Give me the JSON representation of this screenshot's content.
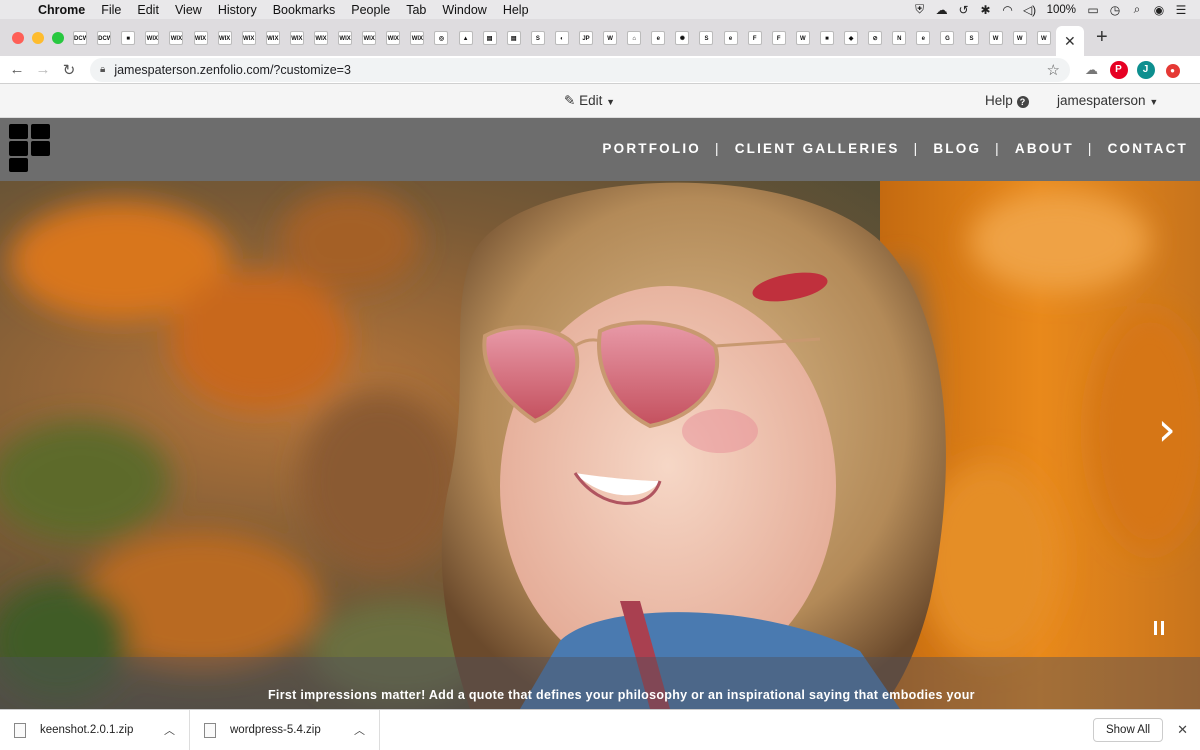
{
  "menubar": {
    "items": [
      "Chrome",
      "File",
      "Edit",
      "View",
      "History",
      "Bookmarks",
      "People",
      "Tab",
      "Window",
      "Help"
    ],
    "battery": "100%"
  },
  "tabs": {
    "favicons": [
      "DCW",
      "DCW",
      "■",
      "WIX",
      "WIX",
      "WIX",
      "WIX",
      "WIX",
      "WIX",
      "WIX",
      "WIX",
      "WIX",
      "WIX",
      "WIX",
      "WIX",
      "◎",
      "▲",
      "▤",
      "▤",
      "S",
      "◐",
      "JP",
      "W",
      "⌂",
      "e",
      "✺",
      "S",
      "e",
      "F",
      "F",
      "W",
      "■",
      "◆",
      "⊘",
      "N",
      "e",
      "G",
      "S",
      "W",
      "W",
      "W"
    ],
    "close_glyph": "✕",
    "new_tab": "+"
  },
  "toolbar": {
    "url": "jamespaterson.zenfolio.com/?customize=3",
    "avatar_letter": "J"
  },
  "editbar": {
    "edit_label": "Edit",
    "help_label": "Help",
    "username": "jamespaterson"
  },
  "site": {
    "nav": [
      "PORTFOLIO",
      "CLIENT GALLERIES",
      "BLOG",
      "ABOUT",
      "CONTACT"
    ],
    "separator": "|"
  },
  "hero": {
    "quote": "First impressions matter! Add a quote that defines your philosophy or an inspirational saying that embodies your"
  },
  "downloads": {
    "files": [
      {
        "name": "keenshot.2.0.1.zip"
      },
      {
        "name": "wordpress-5.4.zip"
      }
    ],
    "show_all": "Show All"
  },
  "colors": {
    "header_bg": "#6d6d6d",
    "traffic_close": "#fe5f57",
    "traffic_min": "#febc2e",
    "traffic_max": "#28c840"
  }
}
